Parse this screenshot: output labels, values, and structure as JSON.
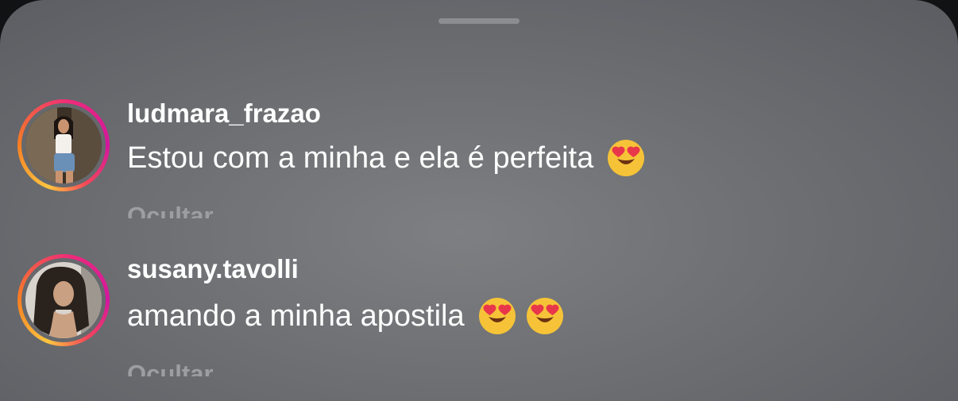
{
  "comments": [
    {
      "username": "ludmara_frazao",
      "text": "Estou com a minha e ela é perfeita",
      "emojis": [
        "heart-eyes-emoji"
      ],
      "action_label": "Ocultar"
    },
    {
      "username": "susany.tavolli",
      "text": "amando a minha apostila",
      "emojis": [
        "heart-eyes-emoji",
        "heart-eyes-emoji"
      ],
      "action_label": "Ocultar"
    }
  ],
  "colors": {
    "sheet_background": "#6f7174",
    "username": "#ffffff",
    "comment_text": "#ffffff",
    "action_text": "#9c9ea2",
    "story_ring": [
      "#fbc540",
      "#f77f22",
      "#ee2a7b",
      "#d3169f"
    ]
  }
}
